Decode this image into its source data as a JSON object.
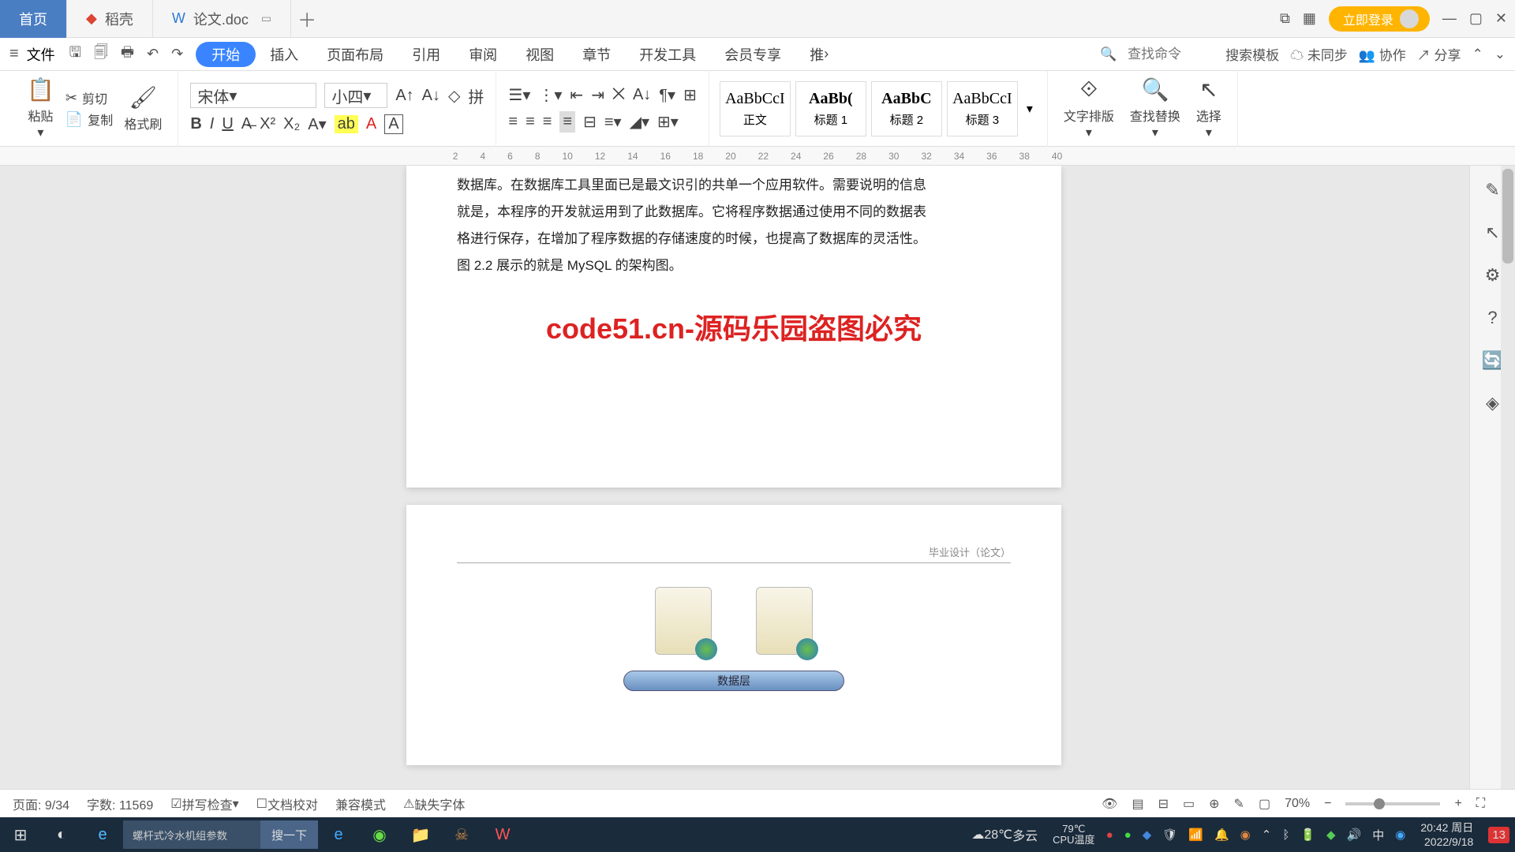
{
  "tabs": {
    "home": "首页",
    "daoke": "稻壳",
    "doc": "论文.doc"
  },
  "winbtns": {
    "login": "立即登录"
  },
  "menubar": {
    "file": "文件",
    "items": [
      "开始",
      "插入",
      "页面布局",
      "引用",
      "审阅",
      "视图",
      "章节",
      "开发工具",
      "会员专享",
      "推"
    ],
    "search_placeholder": "查找命令",
    "template": "搜索模板",
    "unsync": "未同步",
    "collab": "协作",
    "share": "分享"
  },
  "ribbon": {
    "paste": "粘贴",
    "cut": "剪切",
    "copy": "复制",
    "format": "格式刷",
    "font": "宋体",
    "size": "小四",
    "styles": [
      "正文",
      "标题 1",
      "标题 2",
      "标题 3"
    ],
    "preview": "AaBbCcI",
    "textlayout": "文字排版",
    "findreplace": "查找替换",
    "select": "选择"
  },
  "ruler": [
    "2",
    "4",
    "6",
    "8",
    "10",
    "12",
    "14",
    "16",
    "18",
    "20",
    "22",
    "24",
    "26",
    "28",
    "30",
    "32",
    "34",
    "36",
    "38",
    "40"
  ],
  "doc": {
    "line0": "数据库。在数据库工具里面已是最文识引的共单一个应用软件。需要说明的信息",
    "line1": "就是，本程序的开发就运用到了此数据库。它将程序数据通过使用不同的数据表",
    "line2": "格进行保存，在增加了程序数据的存储速度的时候，也提高了数据库的灵活性。",
    "line3": "图 2.2 展示的就是 MySQL 的架构图。",
    "watermark_main": "code51.cn-源码乐园盗图必究",
    "watermark_small": "code51.cn",
    "page_header": "毕业设计（论文）",
    "data_layer": "数据层"
  },
  "status": {
    "page": "页面: 9/34",
    "words": "字数: 11569",
    "spell": "拼写检查",
    "review": "文档校对",
    "compat": "兼容模式",
    "missing": "缺失字体",
    "zoom": "70%"
  },
  "taskbar": {
    "search_text": "螺杆式冷水机组参数",
    "search_btn": "搜一下",
    "weather_temp": "28℃",
    "weather_desc": "多云",
    "cpu_label": "CPU温度",
    "cpu_temp": "79℃",
    "ime": "中",
    "time": "20:42 周日",
    "date": "2022/9/18",
    "notif": "13"
  }
}
